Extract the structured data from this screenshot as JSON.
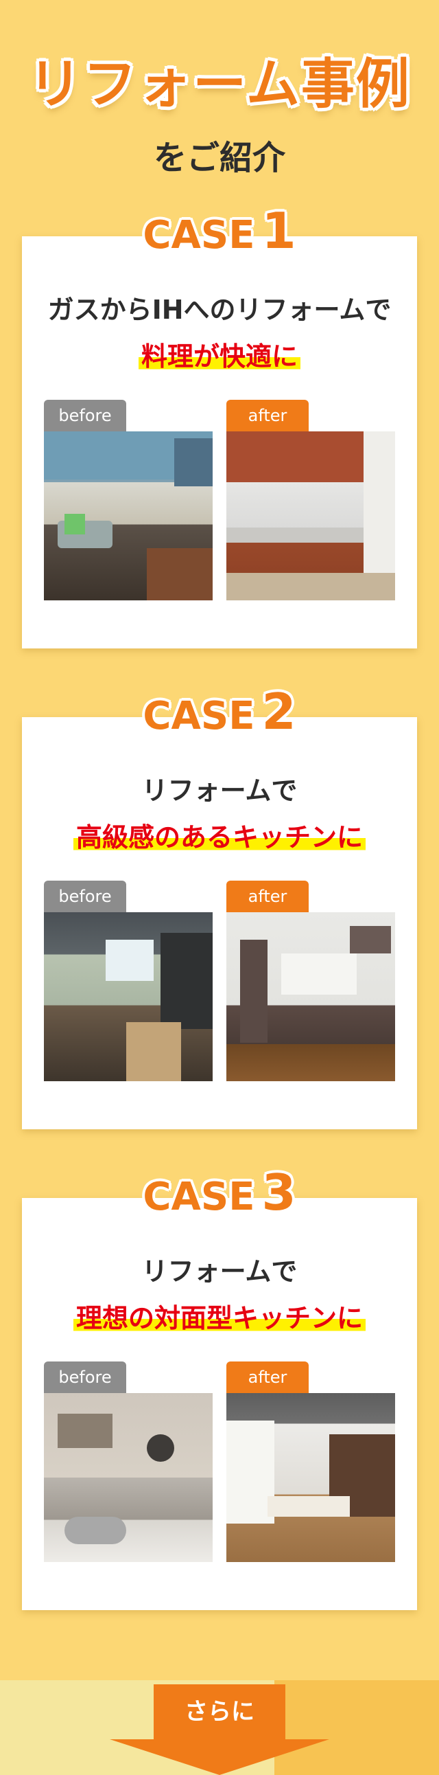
{
  "hero": {
    "title": "リフォーム事例",
    "subtitle": "をご紹介"
  },
  "cases": [
    {
      "label": "CASE",
      "number": "1",
      "headline": "ガスからIHへのリフォームで",
      "highlight": "料理が快適に",
      "before_label": "before",
      "after_label": "after"
    },
    {
      "label": "CASE",
      "number": "2",
      "headline": "リフォームで",
      "highlight": "高級感のあるキッチンに",
      "before_label": "before",
      "after_label": "after"
    },
    {
      "label": "CASE",
      "number": "3",
      "headline": "リフォームで",
      "highlight": "理想の対面型キッチンに",
      "before_label": "before",
      "after_label": "after"
    }
  ],
  "more": {
    "label": "さらに"
  },
  "colors": {
    "accent": "#f07b18",
    "background": "#fcd774",
    "highlight_text": "#e60012",
    "marker": "#fff100"
  }
}
